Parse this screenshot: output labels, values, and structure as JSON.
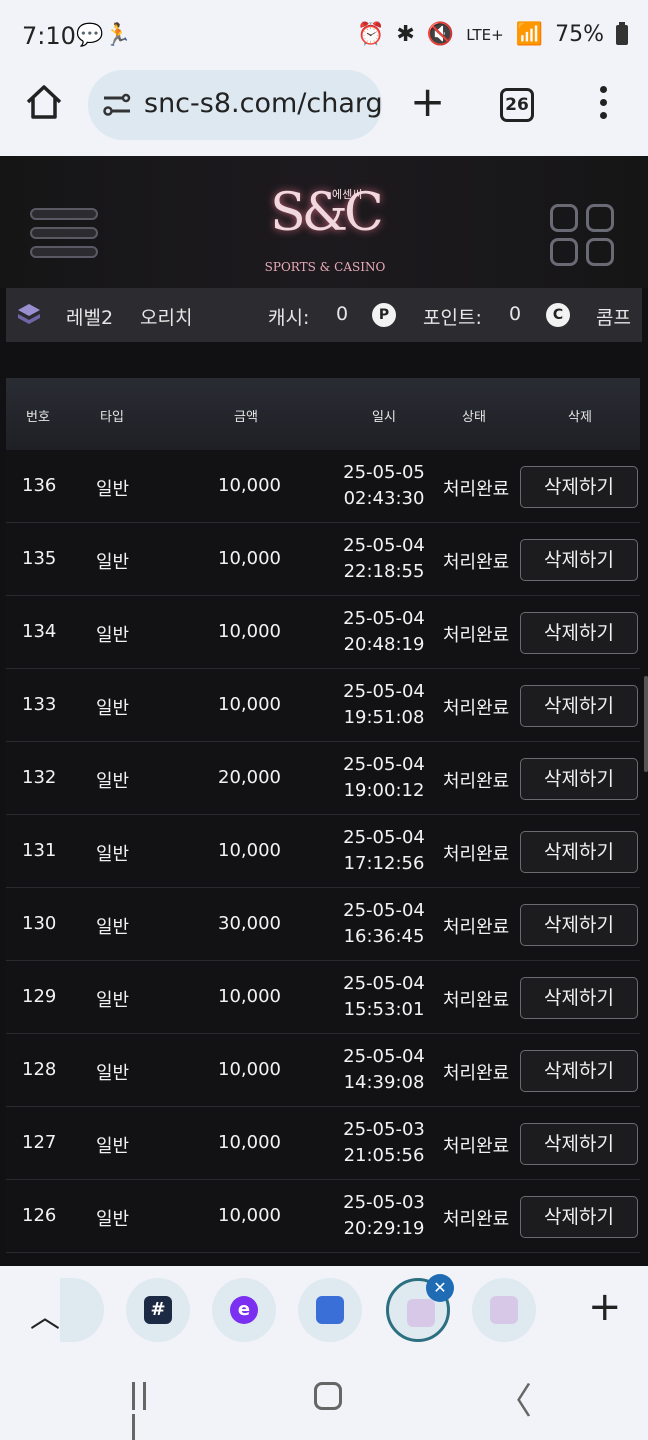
{
  "status_bar": {
    "time": "7:10",
    "network": "LTE+",
    "battery": "75%"
  },
  "browser": {
    "url": "snc-s8.com/charg",
    "tabs_count": "26"
  },
  "site": {
    "logo_mark": "S&C",
    "logo_korean": "에센씨",
    "logo_sub": "SPORTS & CASINO"
  },
  "user": {
    "level": "레벨2",
    "name": "오리치",
    "cash_label": "캐시:",
    "cash_value": "0",
    "point_label": "포인트:",
    "point_value": "0",
    "comp_label": "콤프",
    "point_badge": "P",
    "comp_badge": "C"
  },
  "table": {
    "headers": {
      "no": "번호",
      "type": "타입",
      "amount": "금액",
      "date": "일시",
      "status": "상태",
      "delete": "삭제"
    },
    "rows": [
      {
        "no": "136",
        "type": "일반",
        "amount": "10,000",
        "date": "25-05-05",
        "time": "02:43:30",
        "status": "처리완료",
        "action": "삭제하기"
      },
      {
        "no": "135",
        "type": "일반",
        "amount": "10,000",
        "date": "25-05-04",
        "time": "22:18:55",
        "status": "처리완료",
        "action": "삭제하기"
      },
      {
        "no": "134",
        "type": "일반",
        "amount": "10,000",
        "date": "25-05-04",
        "time": "20:48:19",
        "status": "처리완료",
        "action": "삭제하기"
      },
      {
        "no": "133",
        "type": "일반",
        "amount": "10,000",
        "date": "25-05-04",
        "time": "19:51:08",
        "status": "처리완료",
        "action": "삭제하기"
      },
      {
        "no": "132",
        "type": "일반",
        "amount": "20,000",
        "date": "25-05-04",
        "time": "19:00:12",
        "status": "처리완료",
        "action": "삭제하기"
      },
      {
        "no": "131",
        "type": "일반",
        "amount": "10,000",
        "date": "25-05-04",
        "time": "17:12:56",
        "status": "처리완료",
        "action": "삭제하기"
      },
      {
        "no": "130",
        "type": "일반",
        "amount": "30,000",
        "date": "25-05-04",
        "time": "16:36:45",
        "status": "처리완료",
        "action": "삭제하기"
      },
      {
        "no": "129",
        "type": "일반",
        "amount": "10,000",
        "date": "25-05-04",
        "time": "15:53:01",
        "status": "처리완료",
        "action": "삭제하기"
      },
      {
        "no": "128",
        "type": "일반",
        "amount": "10,000",
        "date": "25-05-04",
        "time": "14:39:08",
        "status": "처리완료",
        "action": "삭제하기"
      },
      {
        "no": "127",
        "type": "일반",
        "amount": "10,000",
        "date": "25-05-03",
        "time": "21:05:56",
        "status": "처리완료",
        "action": "삭제하기"
      },
      {
        "no": "126",
        "type": "일반",
        "amount": "10,000",
        "date": "25-05-03",
        "time": "20:29:19",
        "status": "처리완료",
        "action": "삭제하기"
      }
    ]
  },
  "tab_strip": {
    "tab1_glyph": "#",
    "tab2_glyph": "e",
    "close_glyph": "✕"
  }
}
